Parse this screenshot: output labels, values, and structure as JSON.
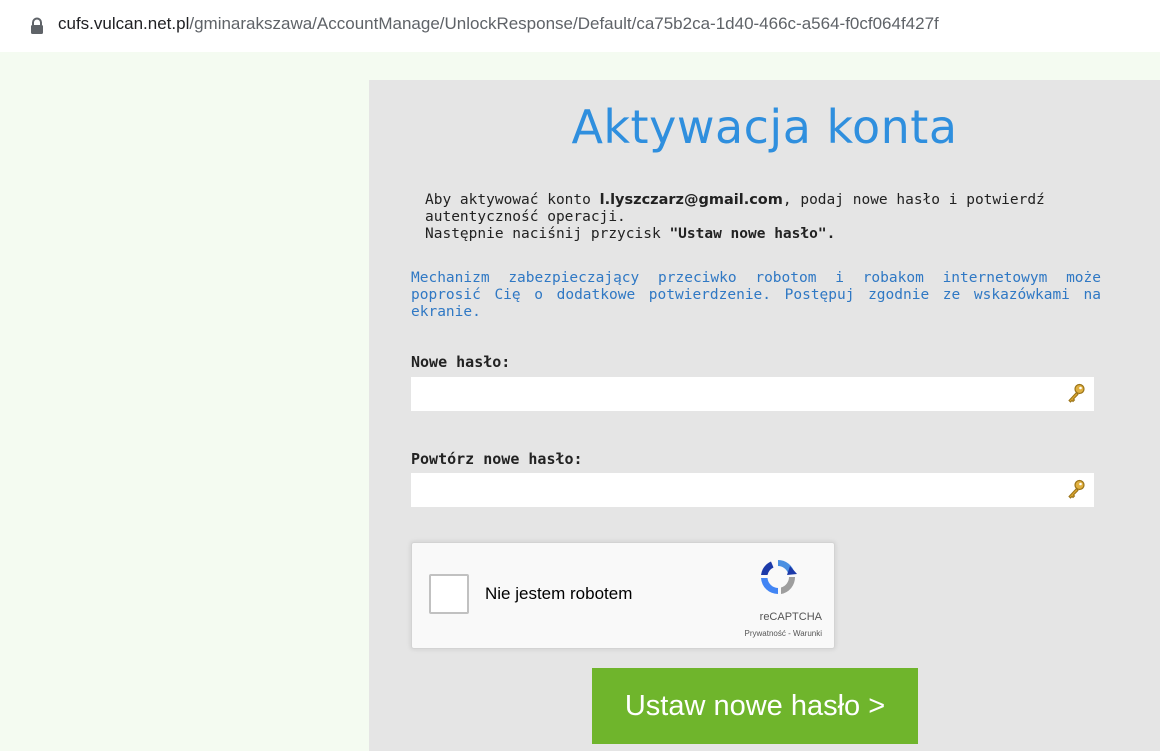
{
  "browser": {
    "url_host": "cufs.vulcan.net.pl",
    "url_path": "/gminarakszawa/AccountManage/UnlockResponse/Default/ca75b2ca-1d40-466c-a564-f0cf064f427f"
  },
  "form": {
    "title": "Aktywacja konta",
    "intro_part1": "Aby aktywować konto ",
    "intro_email": "l.lyszczarz@gmail.com",
    "intro_part2": ", podaj nowe hasło i potwierdź autentyczność operacji.",
    "intro_line2_prefix": "Następnie naciśnij przycisk ",
    "intro_line2_button": "\"Ustaw nowe hasło\".",
    "robot_notice": "Mechanizm zabezpieczający przeciwko robotom i robakom internetowym może poprosić Cię o dodatkowe potwierdzenie. Postępuj zgodnie ze wskazówkami na ekranie.",
    "new_password_label": "Nowe hasło:",
    "new_password_value": "",
    "repeat_password_label": "Powtórz nowe hasło:",
    "repeat_password_value": "",
    "submit_label": "Ustaw nowe hasło >"
  },
  "captcha": {
    "label": "Nie jestem robotem",
    "brand": "reCAPTCHA",
    "links": "Prywatność - Warunki",
    "checked": false
  },
  "colors": {
    "title": "#2f8fde",
    "notice": "#2f78c4",
    "submit_bg": "#6fb52c",
    "panel_bg": "#e5e5e5",
    "page_bg": "#f4fbf1"
  },
  "icons": {
    "address_bar": "lock-icon",
    "password_fields": "key-icon",
    "captcha": "recaptcha-logo-icon"
  }
}
